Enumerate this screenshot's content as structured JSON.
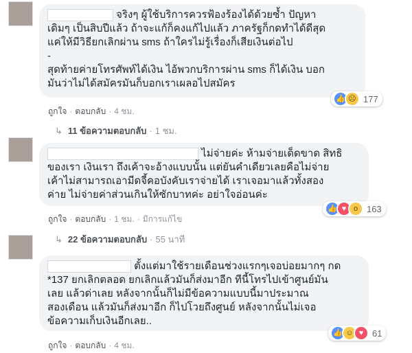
{
  "comments": [
    {
      "lines": [
        "จริงๆ ผู้ใช้บริการควรฟ้องร้องได้ด้วยซ้ำ ปัญหา",
        "เดิมๆ เป็นสิบปีแล้ว ถ้าจะแก้ก็คงแก้ไปแล้ว ภาครัฐก็กดทำได้ดีสุด",
        "แค่ให้มีวิธียกเลิกผ่าน sms ถ้าใครไม่รู้เรื่องก็เสียเงินต่อไป",
        "-",
        "สุดท้ายค่ายโทรศัพท์ได้เงิน ไอ้พวกบริการผ่าน sms ก็ได้เงิน บอก",
        "มันว่าไม่ได้สมัครมันก็บอกเราเผลอไปสมัคร"
      ],
      "reaction_count": "177",
      "reaction_icons": [
        "like-icon",
        "sad-icon"
      ],
      "like_label": "ถูกใจ",
      "reply_label": "ตอบกลับ",
      "time": "4 ชม.",
      "replies_label": "11 ข้อความตอบกลับ",
      "replies_time": "1 ชม."
    },
    {
      "lines": [
        "ไม่จ่ายค่ะ ห้ามจ่ายเด็ดขาด สิทธิ",
        "ของเรา เงินเรา ถึงเค้าจะอ้างแบบนั้น แต่ยันคำเดียวเลยคือไม่จ่าย",
        "เค้าไม่สามารถเอามีดจี้คอบังคับเราจ่ายได้ เราเจอมาแล้วทั้งสอง",
        "ค่าย ไม่จ่ายค่าส่วนเกินให้ซักบาทค่ะ อย่าใจอ่อนค่ะ"
      ],
      "reaction_count": "163",
      "reaction_icons": [
        "like-icon",
        "love-icon",
        "wow-icon"
      ],
      "like_label": "ถูกใจ",
      "reply_label": "ตอบกลับ",
      "time": "1 ชม.",
      "edited_label": "มีการแก้ไข",
      "replies_label": "22 ข้อความตอบกลับ",
      "replies_time": "55 นาที"
    },
    {
      "lines": [
        "ตั้งแต่มาใช้รายเดือนช่วงแรกๆเจอบ่อยมากๆ กด",
        "*137 ยกเลิกตลอด ยกเลิกแล้วมันก็ส่งมาอีก ทีนี้โทรไปเข้าศูนย์มัน",
        "เลย แล้วด่าเลย หลังจากนั้นก็ไม่มีข้อความแบบนี้มาประมาณ",
        "สองเดือน แล้วมันก็ส่งมาอีก ก็ไปโวยถึงศูนย์ หลังจากนั้นไม่เจอ",
        "ข้อความเก็บเงินอีกเลย.."
      ],
      "reaction_count": "61",
      "reaction_icons": [
        "like-icon",
        "haha-icon",
        "love-icon"
      ],
      "like_label": "ถูกใจ",
      "reply_label": "ตอบกลับ",
      "time": "4 ชม."
    }
  ],
  "colors": {
    "bubble": "#f2f3f5",
    "link": "#385898",
    "meta": "#90949c",
    "like": "#5890ff",
    "love": "#f25268",
    "emoji": "#f7c94a"
  }
}
